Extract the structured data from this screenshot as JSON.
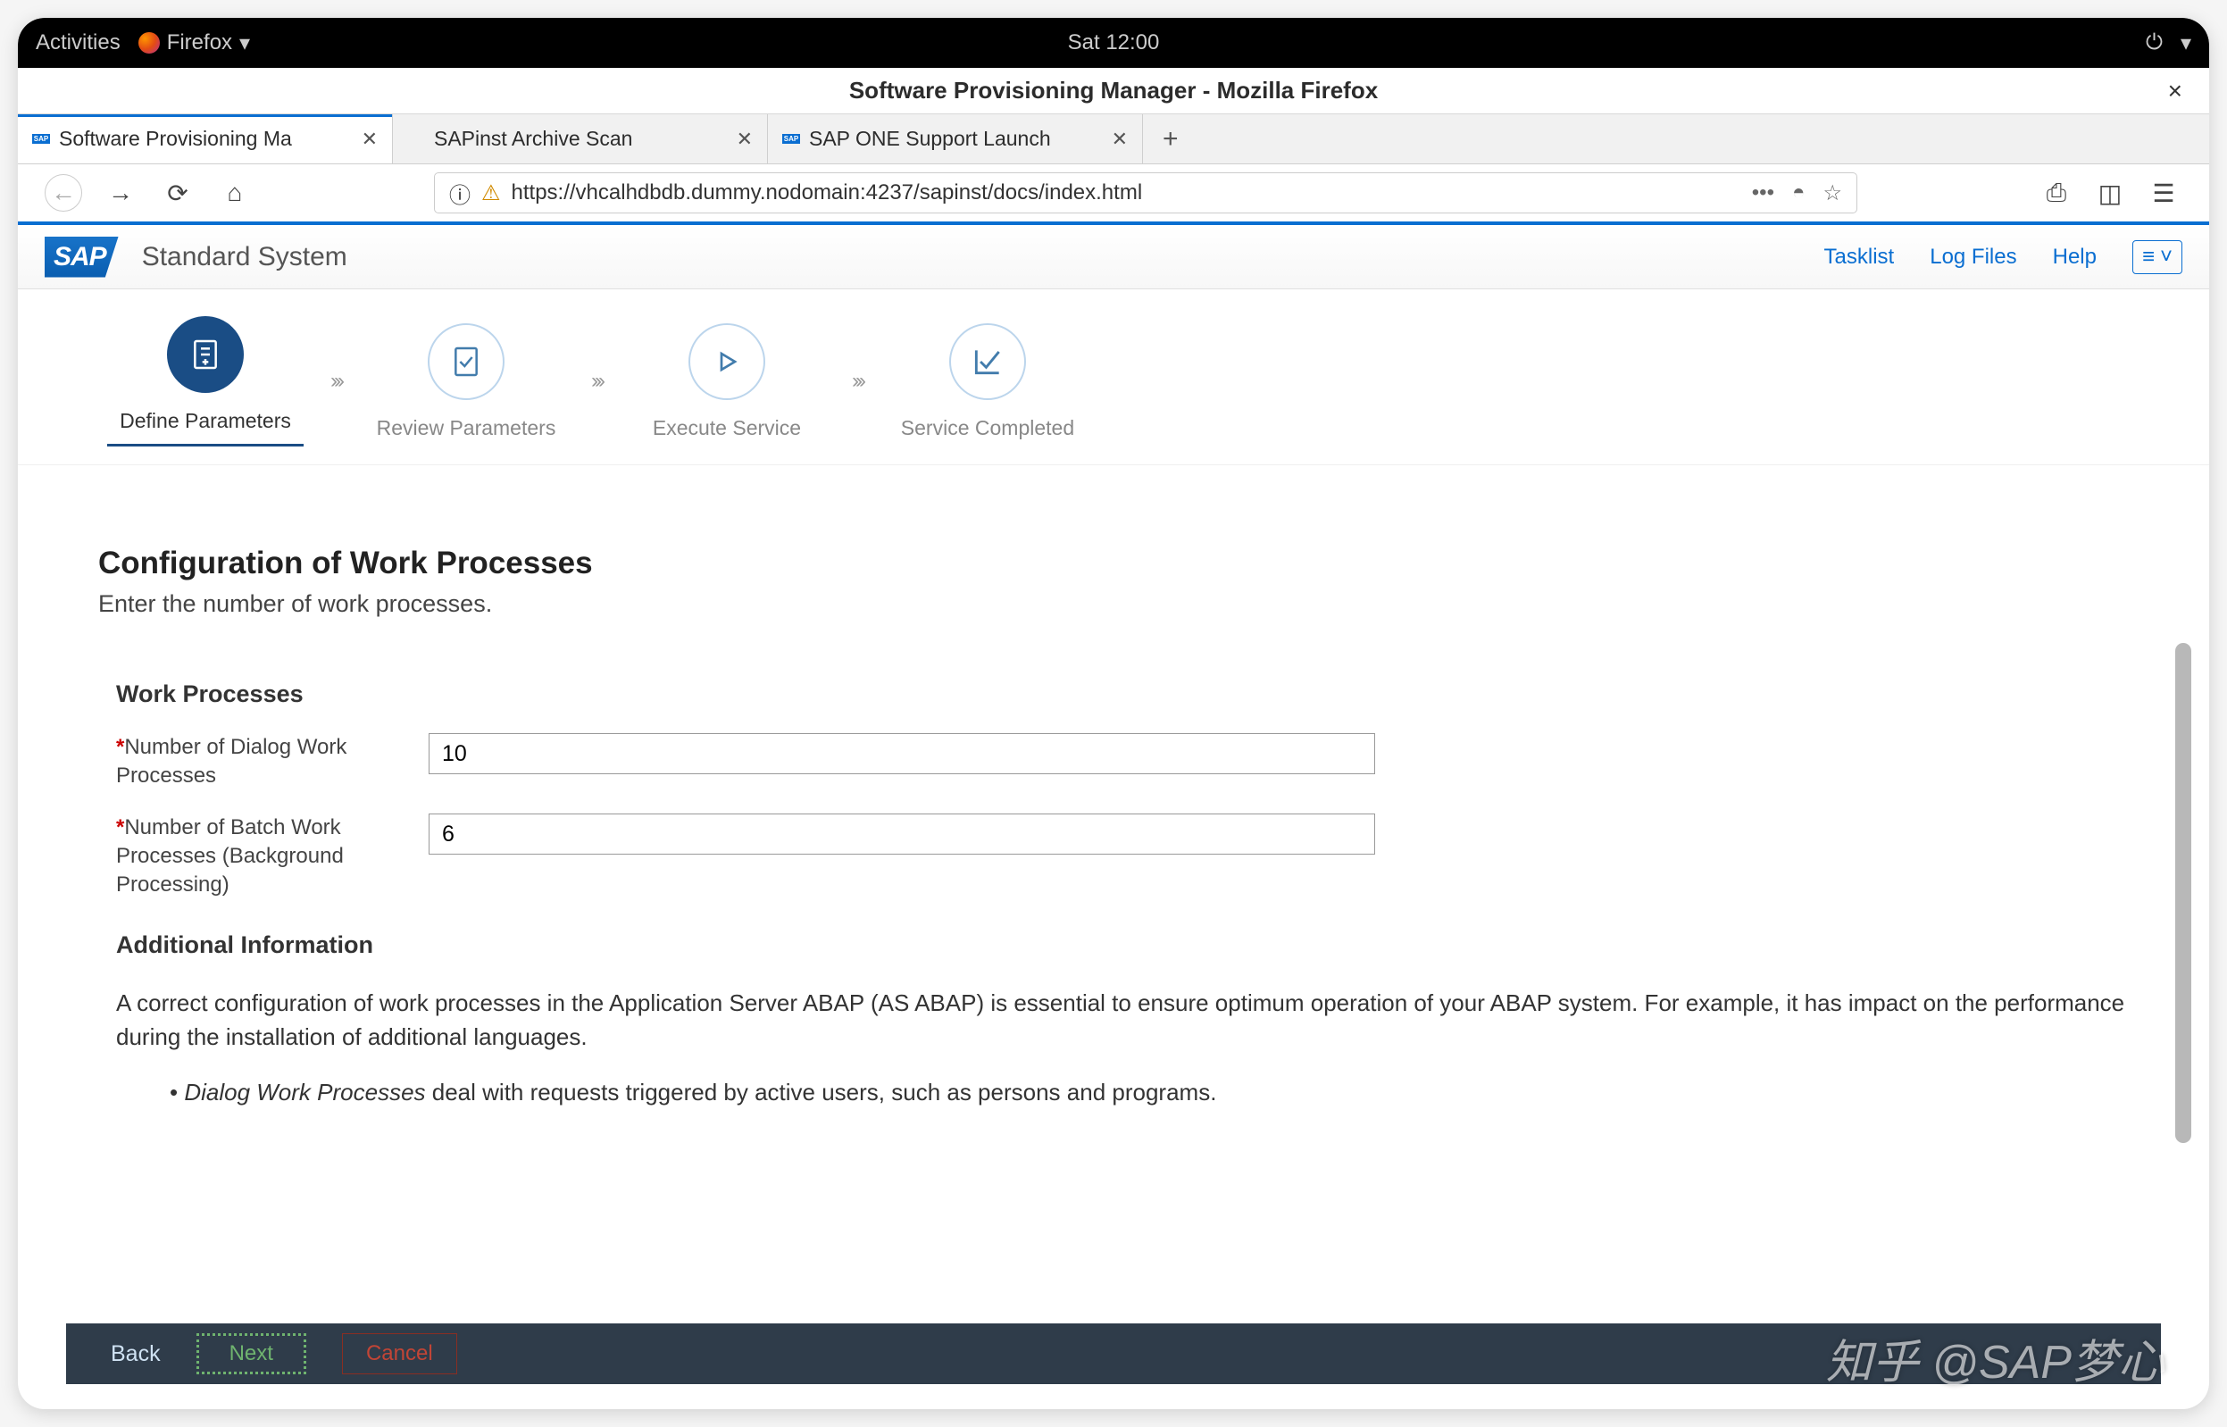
{
  "gnome": {
    "activities": "Activities",
    "app": "Firefox",
    "clock": "Sat 12:00"
  },
  "window": {
    "title": "Software Provisioning Manager - Mozilla Firefox"
  },
  "tabs": [
    {
      "label": "Software Provisioning Ma",
      "active": true,
      "favicon": "sap"
    },
    {
      "label": "SAPinst Archive Scan",
      "active": false,
      "favicon": ""
    },
    {
      "label": "SAP ONE Support Launch",
      "active": false,
      "favicon": "sap"
    }
  ],
  "address": {
    "url": "https://vhcalhdbdb.dummy.nodomain:4237/sapinst/docs/index.html"
  },
  "sap_header": {
    "logo": "SAP",
    "system": "Standard System",
    "links": {
      "tasklist": "Tasklist",
      "logfiles": "Log Files",
      "help": "Help"
    }
  },
  "wizard": [
    {
      "label": "Define Parameters",
      "active": true
    },
    {
      "label": "Review Parameters",
      "active": false
    },
    {
      "label": "Execute Service",
      "active": false
    },
    {
      "label": "Service Completed",
      "active": false
    }
  ],
  "content": {
    "h1": "Configuration of Work Processes",
    "sub": "Enter the number of work processes.",
    "section": "Work Processes",
    "fields": {
      "dialog": {
        "label": "Number of Dialog Work Processes",
        "value": "10"
      },
      "batch": {
        "label": "Number of Batch Work Processes (Background Processing)",
        "value": "6"
      }
    },
    "addl_h": "Additional Information",
    "addl_p": "A correct configuration of work processes in the Application Server ABAP (AS ABAP) is essential to ensure optimum operation of your ABAP system. For example, it has impact on the performance during the installation of additional languages.",
    "addl_li_em": "Dialog Work Processes",
    "addl_li_rest": " deal with requests triggered by active users, such as persons and programs."
  },
  "footer": {
    "back": "Back",
    "next": "Next",
    "cancel": "Cancel"
  },
  "watermark": "知乎 @SAP梦心"
}
